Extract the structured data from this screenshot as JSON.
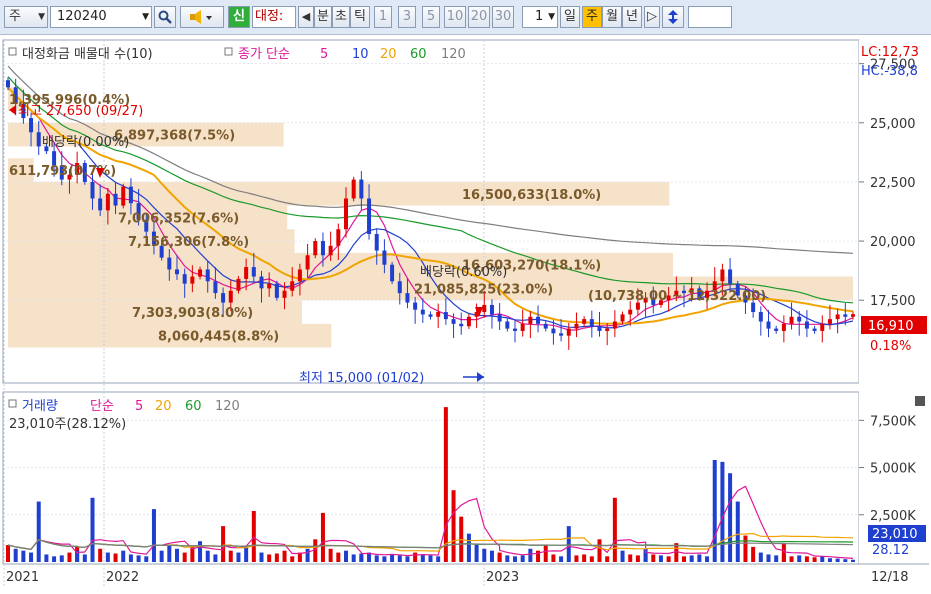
{
  "toolbar": {
    "market_select": "주",
    "stock_code": "120240",
    "search_icon": "search-icon",
    "speaker_icon": "speaker-icon",
    "credit_badge": "신",
    "stock_name": "대정:",
    "prev_arrow": "◀",
    "period_buttons": [
      "분",
      "초",
      "틱"
    ],
    "number_buttons": [
      "1",
      "3",
      "5",
      "10",
      "20",
      "30"
    ],
    "interval_value": "1",
    "interval_caret": "▾",
    "cycle_buttons": [
      "일",
      "주",
      "월",
      "년"
    ],
    "selected_cycle": "주",
    "next_arrow": "▷",
    "updown_icon": "updown-arrow-icon"
  },
  "price_panel": {
    "legend": {
      "title": "대정화금 매물대 수(10)",
      "ma_label": "종가 단순",
      "ma_periods": [
        "5",
        "10",
        "20",
        "60",
        "120"
      ],
      "ma_colors": [
        "#e0189a",
        "#1f3fcf",
        "#f0a400",
        "#1a9a2a",
        "#7f7f7f"
      ]
    },
    "lc_label": "LC:12,73",
    "hc_label": "HC:-38,8",
    "current_price": "16,910",
    "current_change": "0.18%",
    "high_marker": "최고 27,650 (09/27)",
    "low_marker": "최저 15,000 (01/02)",
    "y_ticks": [
      "27,500",
      "25,000",
      "22,500",
      "20,000",
      "17,500"
    ]
  },
  "volume_panel": {
    "legend": {
      "title": "거래량",
      "ma_label": "단순",
      "ma_periods": [
        "5",
        "20",
        "60",
        "120"
      ],
      "ma_colors": [
        "#e0189a",
        "#f0a400",
        "#1a9a2a",
        "#7f7f7f"
      ]
    },
    "current_volume": "23,010주(28.12%)",
    "current_volume_box": "23,010",
    "current_ratio_box": "28.12",
    "y_ticks": [
      "7,500K",
      "5,000K",
      "2,500K"
    ]
  },
  "x_axis": {
    "labels": [
      "2021",
      "2022",
      "2023"
    ],
    "last_date": "12/18"
  },
  "chart_data": {
    "type": "candlestick",
    "title": "대정화금 매물대 수(10)",
    "frequency": "weekly",
    "price_ylim": [
      14000,
      28500
    ],
    "price_range": {
      "high": 27650,
      "high_date": "09/27",
      "low": 15000,
      "low_date": "01/02"
    },
    "last_close": 16910,
    "last_change_pct": 0.18,
    "volume_profile_labels": [
      {
        "price": 26000,
        "text": "1,395,996(0.4%)"
      },
      {
        "price": 24500,
        "text": "6,897,368(7.5%)"
      },
      {
        "price": 23000,
        "text": "611,793(0.7%)"
      },
      {
        "price": 22000,
        "text": "16,500,633(18.0%)"
      },
      {
        "price": 21000,
        "text": "7,006,352(7.6%)"
      },
      {
        "price": 20000,
        "text": "7,156,306(7.8%)"
      },
      {
        "price": 19000,
        "text": "16,603,270(18.1%)"
      },
      {
        "price": 18000,
        "text": "21,085,825(23.0%)"
      },
      {
        "price": 17000,
        "text": "7,303,903(8.0%)"
      },
      {
        "price": 16000,
        "text": "8,060,445(8.8%)"
      }
    ],
    "volume_profile_bands": [
      {
        "low": 25500,
        "high": 26500,
        "pct": 0.4
      },
      {
        "low": 24000,
        "high": 25000,
        "pct": 7.5
      },
      {
        "low": 22500,
        "high": 23500,
        "pct": 0.7
      },
      {
        "low": 21500,
        "high": 22500,
        "pct": 18.0
      },
      {
        "low": 20500,
        "high": 21500,
        "pct": 7.6
      },
      {
        "low": 19500,
        "high": 20500,
        "pct": 7.8
      },
      {
        "low": 18500,
        "high": 19500,
        "pct": 18.1
      },
      {
        "low": 17500,
        "high": 18500,
        "pct": 23.0
      },
      {
        "low": 16500,
        "high": 17500,
        "pct": 8.0
      },
      {
        "low": 15500,
        "high": 16500,
        "pct": 8.8
      }
    ],
    "dividend_labels": [
      "배당락(0.00%)",
      "배당락(0.60%)"
    ],
    "range_label": "(10,738.00 ~ 12,322.00)",
    "close_series": [
      26500,
      25800,
      25200,
      24600,
      24000,
      23800,
      23200,
      22600,
      22800,
      23300,
      22500,
      21800,
      21300,
      22000,
      21500,
      22300,
      21600,
      20900,
      20400,
      19800,
      19300,
      18800,
      18600,
      18200,
      18500,
      18800,
      18300,
      17800,
      17400,
      17900,
      18400,
      18900,
      18500,
      18000,
      18200,
      17600,
      17900,
      18300,
      18800,
      19400,
      20000,
      19400,
      19800,
      20500,
      21800,
      22600,
      21800,
      20300,
      19600,
      19000,
      18300,
      17800,
      17400,
      17100,
      16900,
      16800,
      17000,
      16700,
      16500,
      16400,
      16800,
      17000,
      17300,
      16900,
      16600,
      16300,
      16200,
      16500,
      16800,
      16500,
      16300,
      16100,
      16000,
      16300,
      16500,
      16700,
      16400,
      16200,
      16300,
      16600,
      16900,
      17100,
      17400,
      17600,
      17300,
      17500,
      17700,
      17900,
      17800,
      18000,
      17600,
      17900,
      18300,
      18800,
      18200,
      17700,
      17400,
      17000,
      16600,
      16300,
      16200,
      16500,
      16800,
      16600,
      16300,
      16200,
      16500,
      16700,
      16900,
      16800,
      16910
    ],
    "volume_series_k": [
      900,
      700,
      600,
      500,
      3200,
      400,
      300,
      350,
      500,
      800,
      600,
      400,
      3400,
      700,
      500,
      450,
      600,
      400,
      350,
      300,
      2800,
      600,
      900,
      700,
      500,
      800,
      1100,
      600,
      400,
      350,
      1900,
      600,
      500,
      800,
      2700,
      500,
      400,
      450,
      600,
      300,
      500,
      700,
      1200,
      2600,
      700,
      500,
      600,
      400,
      300,
      450,
      500,
      350,
      300,
      400,
      350,
      300,
      500,
      400,
      350,
      300,
      8200,
      3800,
      2400,
      1500,
      900,
      700,
      600,
      500,
      400,
      350,
      300,
      350,
      700,
      600,
      900,
      400,
      300,
      1900,
      350,
      400,
      300,
      1200,
      300,
      3400,
      600,
      400,
      350,
      500,
      700,
      400,
      350,
      300,
      1000,
      300,
      350,
      400,
      300,
      5400,
      5300,
      4700,
      3200,
      1400,
      800,
      500,
      400,
      350,
      1000,
      400,
      300,
      350,
      300,
      250,
      300,
      200,
      180,
      150,
      120
    ],
    "volume_ylim": [
      0,
      9000
    ],
    "ma_periods": [
      5,
      10,
      20,
      60,
      120
    ]
  }
}
